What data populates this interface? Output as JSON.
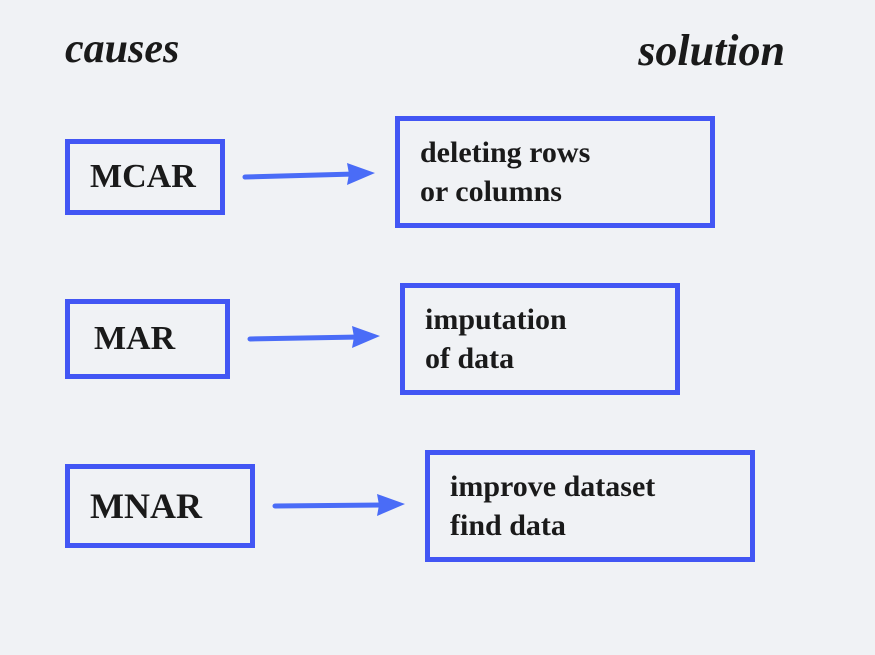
{
  "header": {
    "left": "causes",
    "right": "solution"
  },
  "rows": [
    {
      "cause": "MCAR",
      "solution_line1": "deleting rows",
      "solution_line2": "or columns"
    },
    {
      "cause": "MAR",
      "solution_line1": "imputation",
      "solution_line2": "of data"
    },
    {
      "cause": "MNAR",
      "solution_line1": "improve dataset",
      "solution_line2": "find data"
    }
  ],
  "colors": {
    "box_border": "#4256f4",
    "arrow": "#4a6cf7",
    "text": "#1a1a1a",
    "bg": "#f0f2f5"
  }
}
